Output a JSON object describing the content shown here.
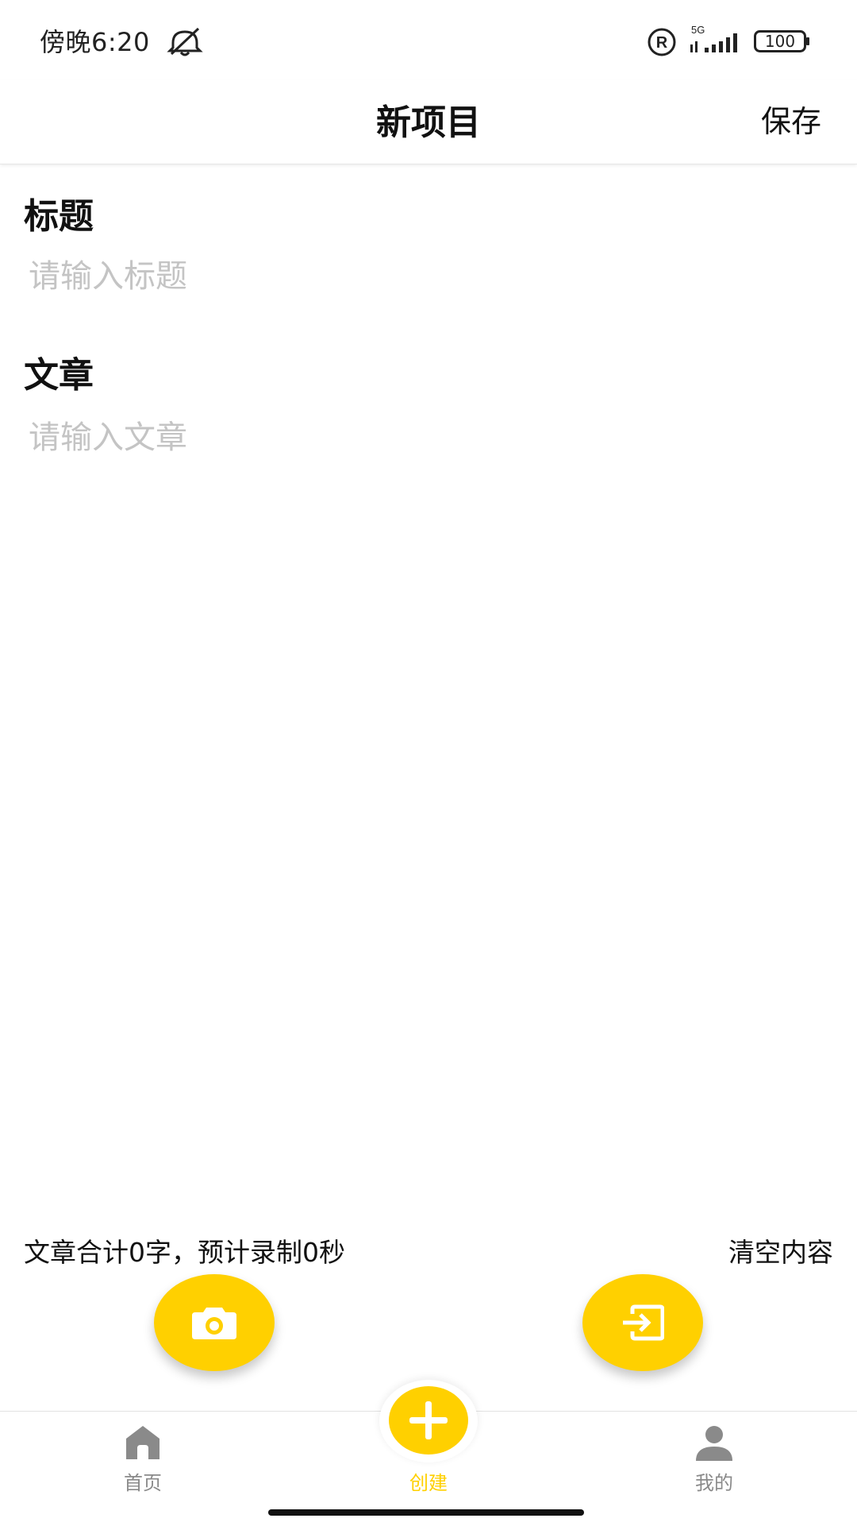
{
  "status_bar": {
    "time": "傍晚6:20",
    "network": "5G",
    "battery": "100"
  },
  "header": {
    "title": "新项目",
    "save_label": "保存"
  },
  "form": {
    "title_label": "标题",
    "title_placeholder": "请输入标题",
    "title_value": "",
    "article_label": "文章",
    "article_placeholder": "请输入文章",
    "article_value": ""
  },
  "footer_info": {
    "word_count_text": "文章合计0字，预计录制0秒",
    "clear_label": "清空内容"
  },
  "fabs": {
    "camera_icon": "camera-icon",
    "import_icon": "import-icon"
  },
  "bottom_nav": {
    "items": [
      {
        "label": "首页",
        "icon": "home-icon"
      },
      {
        "label": "创建",
        "icon": "plus-icon",
        "active": true
      },
      {
        "label": "我的",
        "icon": "user-icon"
      }
    ]
  },
  "colors": {
    "accent": "#FFD000",
    "inactive_nav": "#8A8A8A",
    "placeholder": "#C4C4C4"
  }
}
